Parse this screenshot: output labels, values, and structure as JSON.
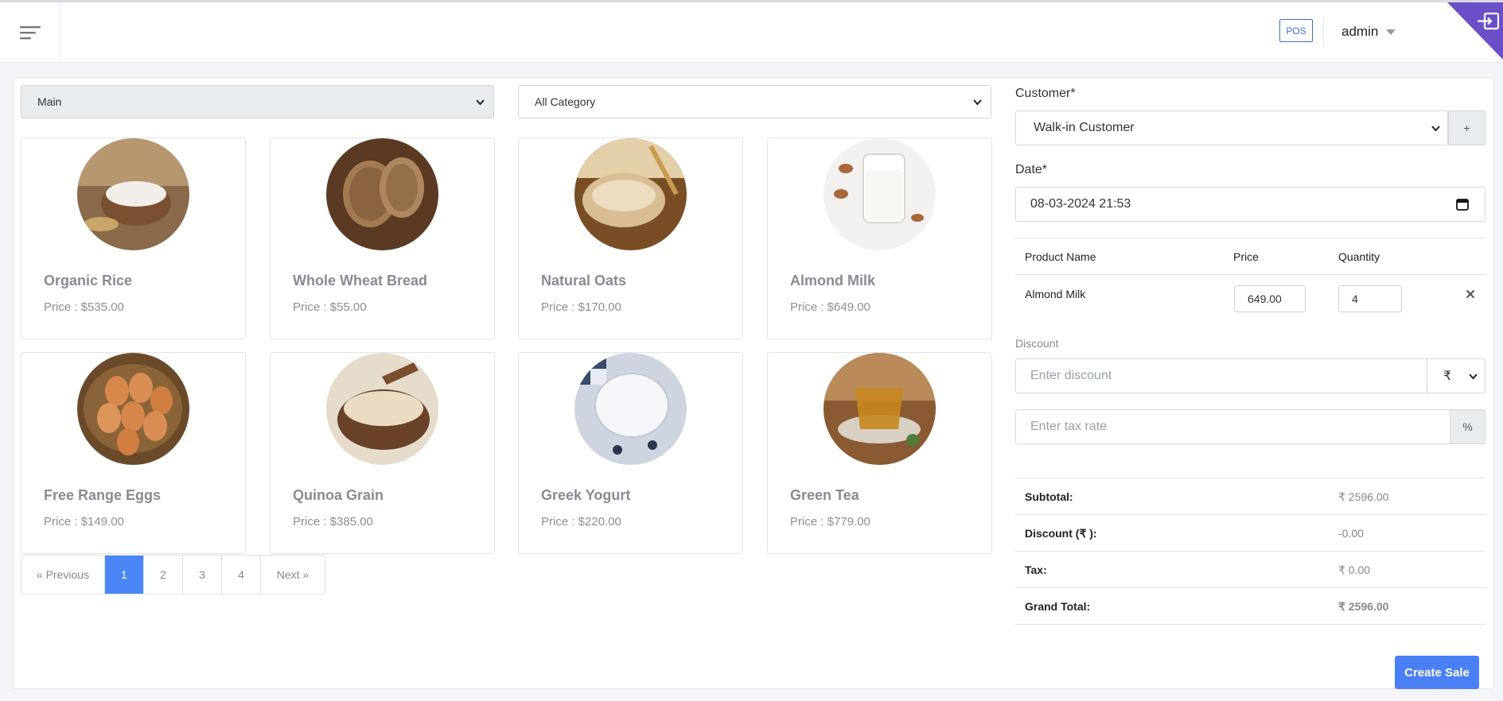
{
  "header": {
    "pos_label": "POS",
    "user_name": "admin"
  },
  "filters": {
    "warehouse": "Main",
    "category": "All Category"
  },
  "products": [
    {
      "name": "Organic Rice",
      "price": "Price : $535.00"
    },
    {
      "name": "Whole Wheat Bread",
      "price": "Price : $55.00"
    },
    {
      "name": "Natural Oats",
      "price": "Price : $170.00"
    },
    {
      "name": "Almond Milk",
      "price": "Price : $649.00"
    },
    {
      "name": "Free Range Eggs",
      "price": "Price : $149.00"
    },
    {
      "name": "Quinoa Grain",
      "price": "Price : $385.00"
    },
    {
      "name": "Greek Yogurt",
      "price": "Price : $220.00"
    },
    {
      "name": "Green Tea",
      "price": "Price : $779.00"
    }
  ],
  "pagination": {
    "previous": "« Previous",
    "pages": [
      "1",
      "2",
      "3",
      "4"
    ],
    "next": "Next »",
    "active_page": "1"
  },
  "sale": {
    "customer_label": "Customer*",
    "customer_value": "Walk-in Customer",
    "add_customer": "+",
    "date_label": "Date*",
    "date_value": "08-03-2024  21:53",
    "columns": {
      "product": "Product Name",
      "price": "Price",
      "quantity": "Quantity"
    },
    "items": [
      {
        "product": "Almond Milk",
        "price": "649.00",
        "quantity": "4"
      }
    ],
    "discount_label": "Discount",
    "discount_placeholder": "Enter discount",
    "discount_type": "₹",
    "tax_placeholder": "Enter tax rate",
    "tax_unit": "%",
    "summary": {
      "subtotal_label": "Subtotal:",
      "subtotal": "₹ 2596.00",
      "discount_label": "Discount (₹ ):",
      "discount": "-0.00",
      "tax_label": "Tax:",
      "tax": "₹ 0.00",
      "grand_label": "Grand Total:",
      "grand": "₹ 2596.00"
    },
    "create_button": "Create Sale"
  },
  "colors": {
    "accent": "#4a86f5",
    "corner": "#6a4fc8"
  }
}
